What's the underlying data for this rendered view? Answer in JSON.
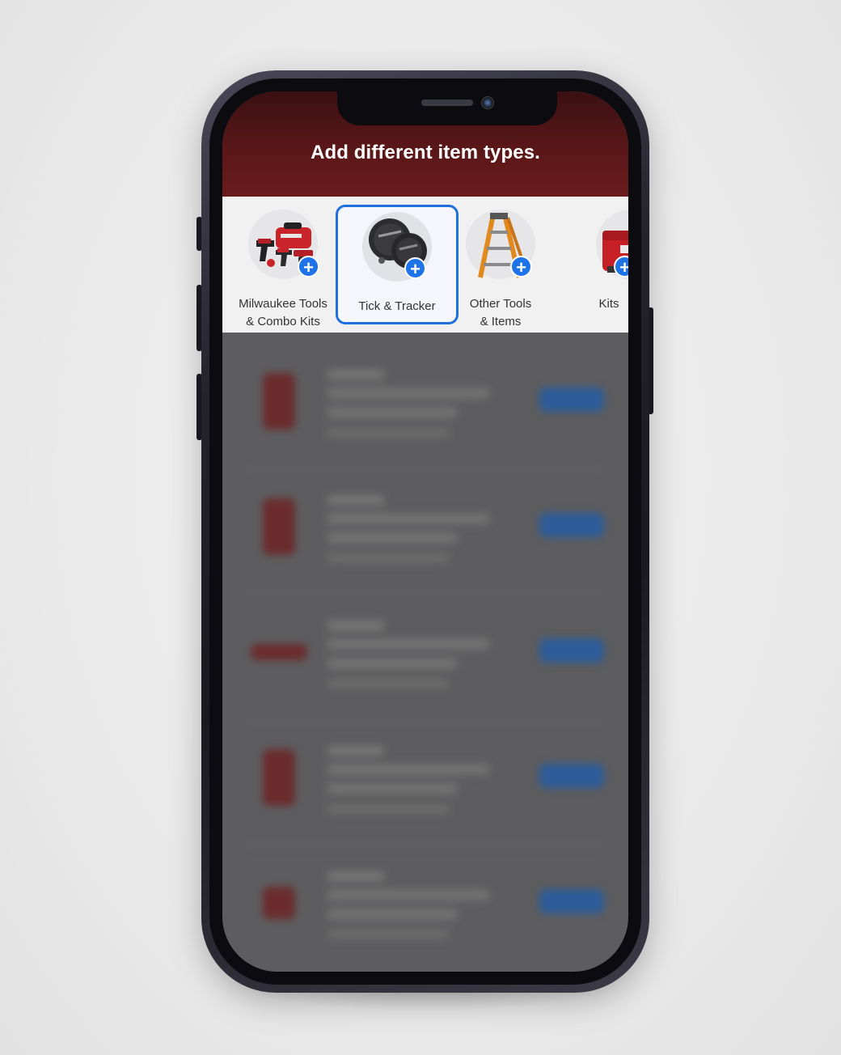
{
  "screen": {
    "headline": "Add different item types."
  },
  "carousel": {
    "items": [
      {
        "label": "Milwaukee Tools\n& Combo Kits",
        "icon": "tool-kit-icon",
        "selected": false
      },
      {
        "label": "Tick & Tracker",
        "icon": "tracker-tag-icon",
        "selected": true
      },
      {
        "label": "Other Tools\n& Items",
        "icon": "ladder-icon",
        "selected": false
      },
      {
        "label": "Kits",
        "icon": "toolbox-icon",
        "selected": false
      }
    ],
    "add_icon": "plus-icon"
  },
  "colors": {
    "accent": "#1f73e8",
    "selection_border": "#1f6fdc",
    "header_red": "#5a1718"
  }
}
